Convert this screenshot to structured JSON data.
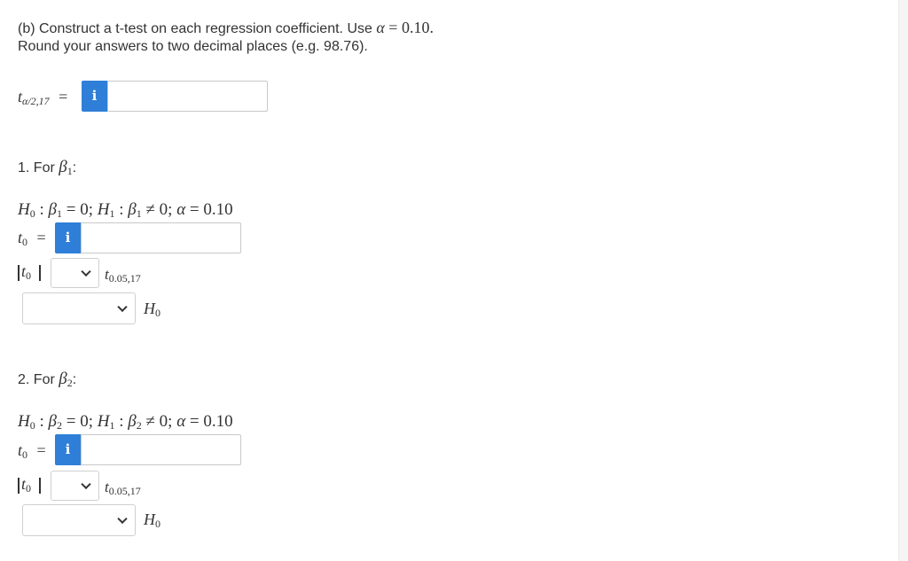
{
  "instructions": {
    "line1_prefix": "(b) Construct a t-test on each regression coefficient. Use ",
    "alpha_symbol": "α",
    "alpha_eq": " = 0.10.",
    "line2": "Round your answers to two decimal places (e.g. 98.76)."
  },
  "t_critical": {
    "t": "t",
    "sub": "α/2,17",
    "eq": "=",
    "info_glyph": "i",
    "value": ""
  },
  "sections": [
    {
      "heading_prefix": "1. For ",
      "beta": "β",
      "beta_sub": "1",
      "heading_suffix": ":",
      "hyp": {
        "h0": "H",
        "h0_sub": "0",
        "c1": " : ",
        "b": "β",
        "b_sub": "1",
        "eq0": " = 0; ",
        "h1": "H",
        "h1_sub": "1",
        "c2": " : ",
        "b2": "β",
        "b2_sub": "1",
        "neq": " ≠ 0; ",
        "a": "α",
        "aeq": " = 0.10"
      },
      "t0": {
        "t": "t",
        "sub": "0",
        "eq": "=",
        "info_glyph": "i",
        "value": ""
      },
      "compare": {
        "abs_t": "t",
        "abs_sub": "0",
        "select_value": "",
        "crit_t": "t",
        "crit_sub": "0.05,17"
      },
      "decision": {
        "select_value": "",
        "h": "H",
        "h_sub": "0"
      }
    },
    {
      "heading_prefix": "2. For ",
      "beta": "β",
      "beta_sub": "2",
      "heading_suffix": ":",
      "hyp": {
        "h0": "H",
        "h0_sub": "0",
        "c1": " : ",
        "b": "β",
        "b_sub": "2",
        "eq0": " = 0; ",
        "h1": "H",
        "h1_sub": "1",
        "c2": " : ",
        "b2": "β",
        "b2_sub": "2",
        "neq": " ≠ 0; ",
        "a": "α",
        "aeq": " = 0.10"
      },
      "t0": {
        "t": "t",
        "sub": "0",
        "eq": "=",
        "info_glyph": "i",
        "value": ""
      },
      "compare": {
        "abs_t": "t",
        "abs_sub": "0",
        "select_value": "",
        "crit_t": "t",
        "crit_sub": "0.05,17"
      },
      "decision": {
        "select_value": "",
        "h": "H",
        "h_sub": "0"
      }
    }
  ]
}
